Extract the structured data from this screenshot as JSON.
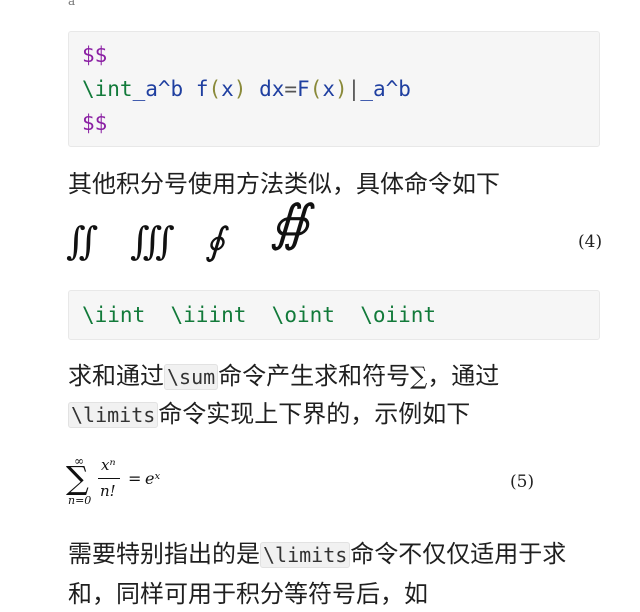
{
  "top_fragment": "a",
  "code_block_1": {
    "line1": "$$",
    "line2_int": "\\int",
    "line2_sub": "_a^b",
    "line2_f": "f",
    "line2_po": "(",
    "line2_x": "x",
    "line2_pc": ")",
    "line2_dx": "dx",
    "line2_eq": "=",
    "line2_F": "F",
    "line2_x2": "x",
    "line2_bar": "|",
    "line2_tail": "_a^b",
    "line3": "$$"
  },
  "para_integrals": "其他积分号使用方法类似，具体命令如下",
  "integral_symbols": {
    "double": "∬",
    "triple": "∭",
    "contour": "∮",
    "surface": "∯"
  },
  "eq4_number": "(4)",
  "code_block_2": {
    "cmd1": "\\iint",
    "cmd2": "\\iiint",
    "cmd3": "\\oint",
    "cmd4": "\\oiint"
  },
  "para_sum": {
    "part1": "求和通过",
    "code_sum": "\\sum",
    "part2": "命令产生求和符号",
    "sum_symbol": "∑",
    "part3": "，通过",
    "code_limits": "\\limits",
    "part4": "命令实现上下界的，示例如下"
  },
  "eq5": {
    "sum_symbol": "∑",
    "upper": "∞",
    "lower": "n=0",
    "numerator": "xⁿ",
    "denominator": "n!",
    "equals": "=",
    "rhs": "eˣ"
  },
  "eq5_number": "(5)",
  "para_note": {
    "part1": "需要特别指出的是",
    "code_limits": "\\limits",
    "part2": "命令不仅仅适用于求",
    "line2": "和，同样可用于积分等符号后，如"
  }
}
